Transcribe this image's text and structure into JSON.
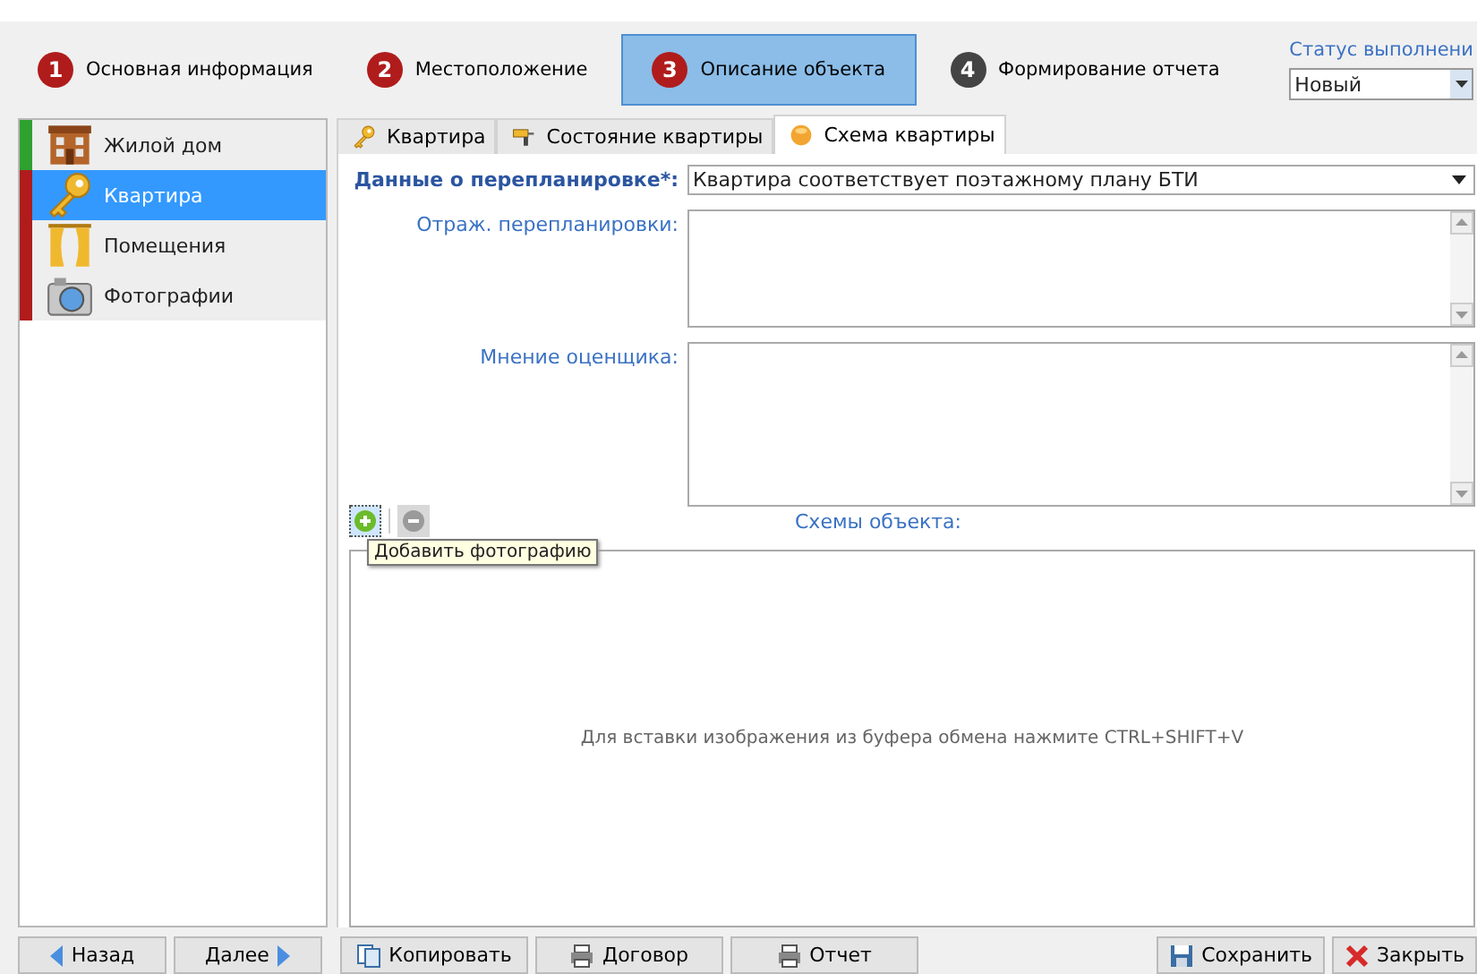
{
  "steps": [
    {
      "number": "1",
      "label": "Основная информация",
      "selected": false,
      "done": true
    },
    {
      "number": "2",
      "label": "Местоположение",
      "selected": false,
      "done": true
    },
    {
      "number": "3",
      "label": "Описание объекта",
      "selected": true,
      "done": true
    },
    {
      "number": "4",
      "label": "Формирование отчета",
      "selected": false,
      "done": false
    }
  ],
  "status": {
    "label": "Статус выполнени",
    "value": "Новый"
  },
  "sidebar": {
    "items": [
      {
        "label": "Жилой дом",
        "color": "#2ea12e",
        "selected": false
      },
      {
        "label": "Квартира",
        "color": "#b01c1c",
        "selected": true
      },
      {
        "label": "Помещения",
        "color": "#b01c1c",
        "selected": false
      },
      {
        "label": "Фотографии",
        "color": "#b01c1c",
        "selected": false
      }
    ]
  },
  "tabs": [
    {
      "label": "Квартира",
      "selected": false
    },
    {
      "label": "Состояние квартиры",
      "selected": false
    },
    {
      "label": "Схема квартиры",
      "selected": true
    }
  ],
  "fields": [
    {
      "kind": "select",
      "label": "Данные о перепланировке*:",
      "value": "Квартира соответствует поэтажному плану БТИ"
    },
    {
      "kind": "textarea",
      "label": "Отраж. перепланировки:"
    },
    {
      "kind": "textarea",
      "label": "Мнение оценщика:"
    }
  ],
  "toolbar": {
    "add_disabled": false,
    "remove_disabled": true,
    "tooltip": "Добавить фотографию",
    "caption": "Схемы объекта:"
  },
  "image_area": {
    "hint": "Для вставки изображения из буфера обмена нажмите CTRL+SHIFT+V"
  },
  "buttons_left": [
    {
      "label": "Назад"
    },
    {
      "label": "Далее"
    },
    {
      "label": "Копировать"
    },
    {
      "label": "Договор"
    },
    {
      "label": "Отчет"
    }
  ],
  "buttons_right": [
    {
      "label": "Сохранить"
    },
    {
      "label": "Закрыть"
    }
  ]
}
